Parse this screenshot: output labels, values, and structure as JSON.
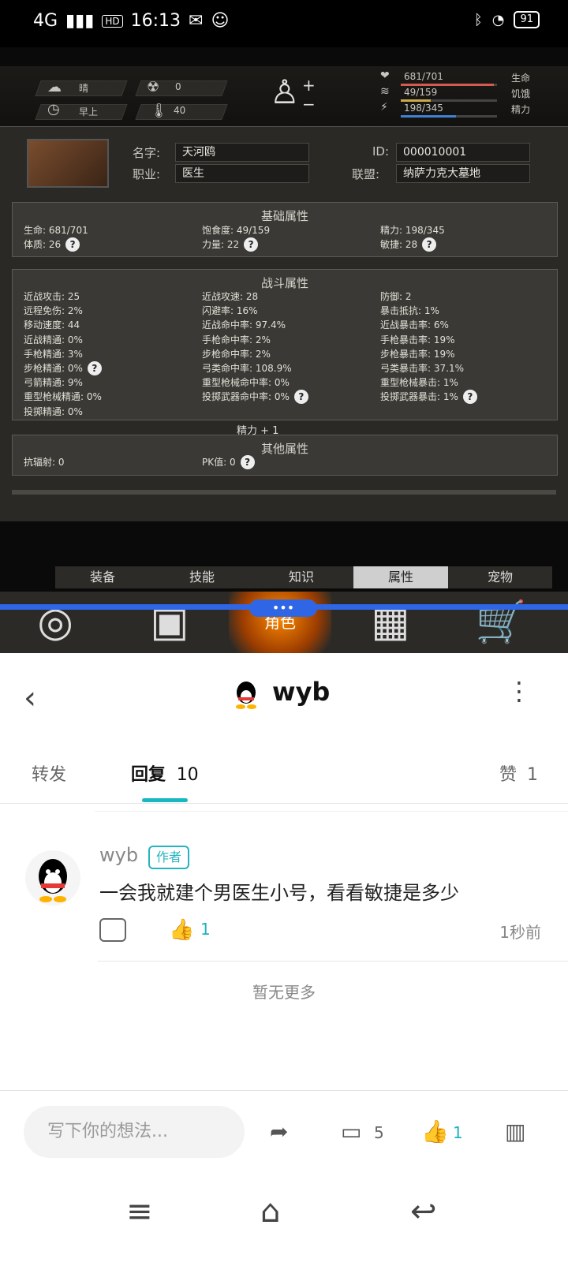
{
  "status": {
    "time": "16:13",
    "network": "4G",
    "hd": "HD",
    "battery": "91"
  },
  "game": {
    "hud": {
      "weather": "晴",
      "radiation": "0",
      "time_of_day": "早上",
      "temperature": "40",
      "stats": [
        {
          "label": "生命",
          "value": "681/701",
          "fill_pct": 97,
          "color": "#d65b4f"
        },
        {
          "label": "饥饿",
          "value": "49/159",
          "fill_pct": 31,
          "color": "#caa94b"
        },
        {
          "label": "精力",
          "value": "198/345",
          "fill_pct": 57,
          "color": "#3e82d1"
        }
      ]
    },
    "profile": {
      "name_label": "名字:",
      "name_value": "天河鸥",
      "job_label": "职业:",
      "job_value": "医生",
      "id_label": "ID:",
      "id_value": "000010001",
      "alliance_label": "联盟:",
      "alliance_value": "纳萨力克大墓地"
    },
    "basic": {
      "title": "基础属性",
      "cells": [
        "生命: 681/701",
        "饱食度: 49/159",
        "精力: 198/345",
        "体质: 26",
        "力量: 22",
        "敏捷: 28"
      ]
    },
    "combat": {
      "title": "战斗属性",
      "cells": [
        "近战攻击: 25",
        "近战攻速: 28",
        "防御: 2",
        "远程免伤: 2%",
        "闪避率: 16%",
        "暴击抵抗: 1%",
        "移动速度: 44",
        "近战命中率: 97.4%",
        "近战暴击率: 6%",
        "近战精通: 0%",
        "手枪命中率: 2%",
        "手枪暴击率: 19%",
        "手枪精通: 3%",
        "步枪命中率: 2%",
        "步枪暴击率: 19%",
        "步枪精通: 0%",
        "弓类命中率: 108.9%",
        "弓类暴击率: 37.1%",
        "弓箭精通: 9%",
        "重型枪械命中率: 0%",
        "重型枪械暴击: 1%",
        "重型枪械精通: 0%",
        "投掷武器命中率: 0%",
        "投掷武器暴击: 1%",
        "投掷精通: 0%"
      ],
      "note": "精力 + 1"
    },
    "other": {
      "title": "其他属性",
      "cells": [
        "抗辐射: 0",
        "PK值: 0"
      ]
    },
    "tabs": [
      "装备",
      "技能",
      "知识",
      "属性",
      "宠物"
    ],
    "active_tab": "属性",
    "bottom_label": "角色"
  },
  "post": {
    "username": "wyb",
    "tabs": {
      "forward": "转发",
      "reply": "回复",
      "reply_count": "10",
      "like": "赞",
      "like_count": "1"
    },
    "comment": {
      "author": "wyb",
      "badge": "作者",
      "text": "一会我就建个男医生小号，看看敏捷是多少",
      "likes": "1",
      "time": "1秒前"
    },
    "no_more": "暂无更多",
    "input_placeholder": "写下你的想法...",
    "comment_count": "5",
    "bottom_like_count": "1"
  }
}
